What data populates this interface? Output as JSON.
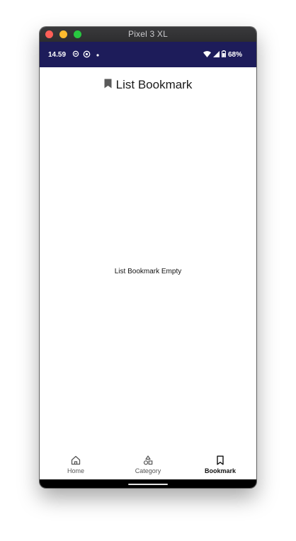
{
  "window": {
    "title": "Pixel 3 XL"
  },
  "status_bar": {
    "time": "14.59",
    "battery": "68%",
    "icons": [
      "sync-icon",
      "settings-icon",
      "notification-dot-icon",
      "wifi-icon",
      "signal-icon",
      "battery-icon"
    ]
  },
  "page": {
    "title": "List Bookmark",
    "title_icon": "bookmark-icon",
    "empty_message": "List Bookmark Empty"
  },
  "bottom_nav": {
    "items": [
      {
        "label": "Home",
        "icon": "home-icon",
        "active": false
      },
      {
        "label": "Category",
        "icon": "category-icon",
        "active": false
      },
      {
        "label": "Bookmark",
        "icon": "bookmark-outline-icon",
        "active": true
      }
    ]
  },
  "colors": {
    "status_bar_bg": "#1d1c5a",
    "active_nav": "#111111",
    "inactive_nav": "#555555"
  }
}
